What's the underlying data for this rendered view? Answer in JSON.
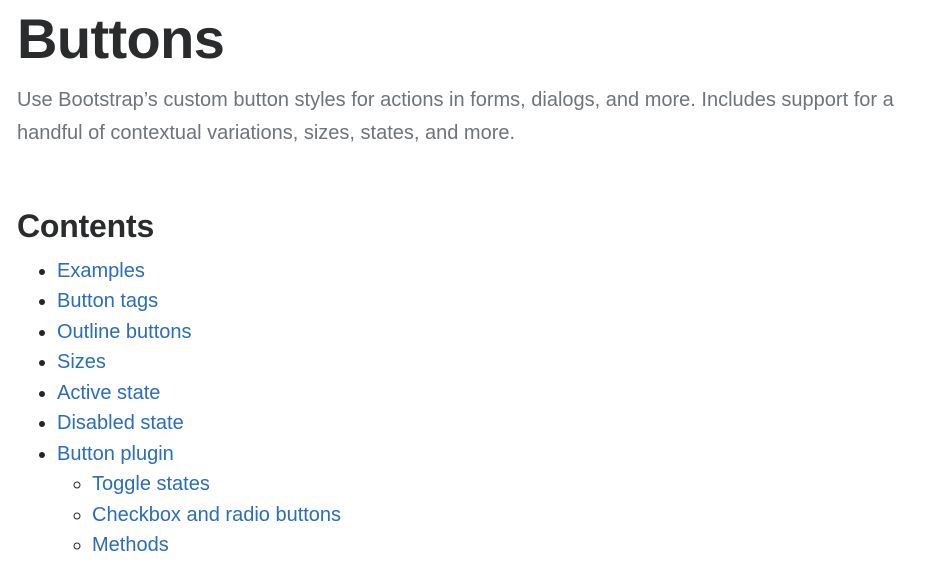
{
  "page": {
    "title": "Buttons",
    "lead": "Use Bootstrap’s custom button styles for actions in forms, dialogs, and more. Includes support for a handful of contextual variations, sizes, states, and more.",
    "contents_heading": "Contents"
  },
  "colors": {
    "link": "#2a6dbb",
    "heading": "#292b2c",
    "lead_text": "#6e7479",
    "background": "#ffffff"
  },
  "contents": {
    "items": [
      {
        "label": "Examples"
      },
      {
        "label": "Button tags"
      },
      {
        "label": "Outline buttons"
      },
      {
        "label": "Sizes"
      },
      {
        "label": "Active state"
      },
      {
        "label": "Disabled state"
      },
      {
        "label": "Button plugin",
        "children": [
          {
            "label": "Toggle states"
          },
          {
            "label": "Checkbox and radio buttons"
          },
          {
            "label": "Methods"
          }
        ]
      }
    ]
  }
}
